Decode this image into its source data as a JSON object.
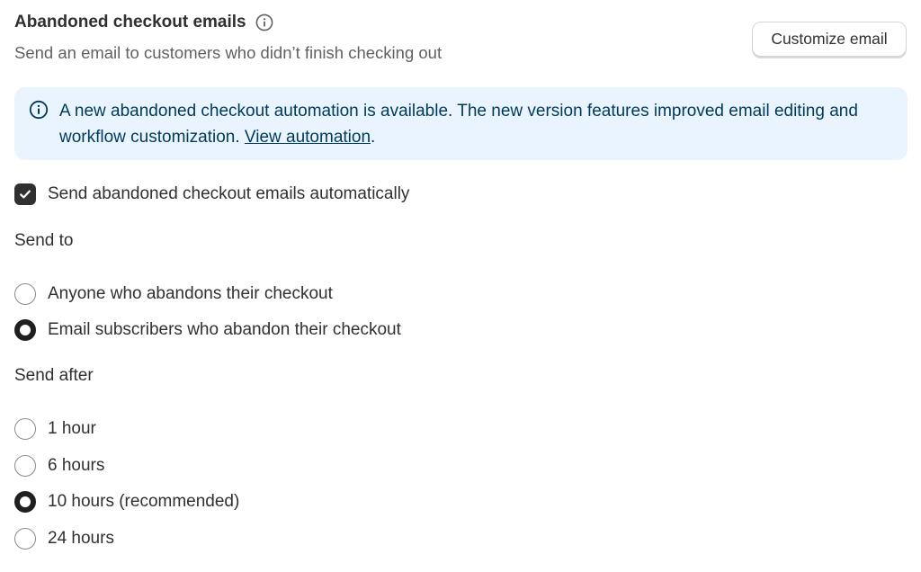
{
  "header": {
    "title": "Abandoned checkout emails",
    "subtitle": "Send an email to customers who didn’t finish checking out",
    "customize_label": "Customize email"
  },
  "banner": {
    "text": "A new abandoned checkout automation is available. The new version features improved email editing and workflow customization. ",
    "link_label": "View automation",
    "suffix": ".",
    "background": "#eaf4ff",
    "text_color": "#003a5a"
  },
  "auto_send": {
    "label": "Send abandoned checkout emails automatically",
    "checked": true
  },
  "send_to": {
    "label": "Send to",
    "options": [
      {
        "label": "Anyone who abandons their checkout",
        "checked": false
      },
      {
        "label": "Email subscribers who abandon their checkout",
        "checked": true
      }
    ]
  },
  "send_after": {
    "label": "Send after",
    "options": [
      {
        "label": "1 hour",
        "checked": false
      },
      {
        "label": "6 hours",
        "checked": false
      },
      {
        "label": "10 hours (recommended)",
        "checked": true
      },
      {
        "label": "24 hours",
        "checked": false
      }
    ]
  },
  "icons": {
    "title_info": "info-icon",
    "banner_info": "info-circle-icon",
    "checkbox_mark": "checkmark-icon"
  }
}
